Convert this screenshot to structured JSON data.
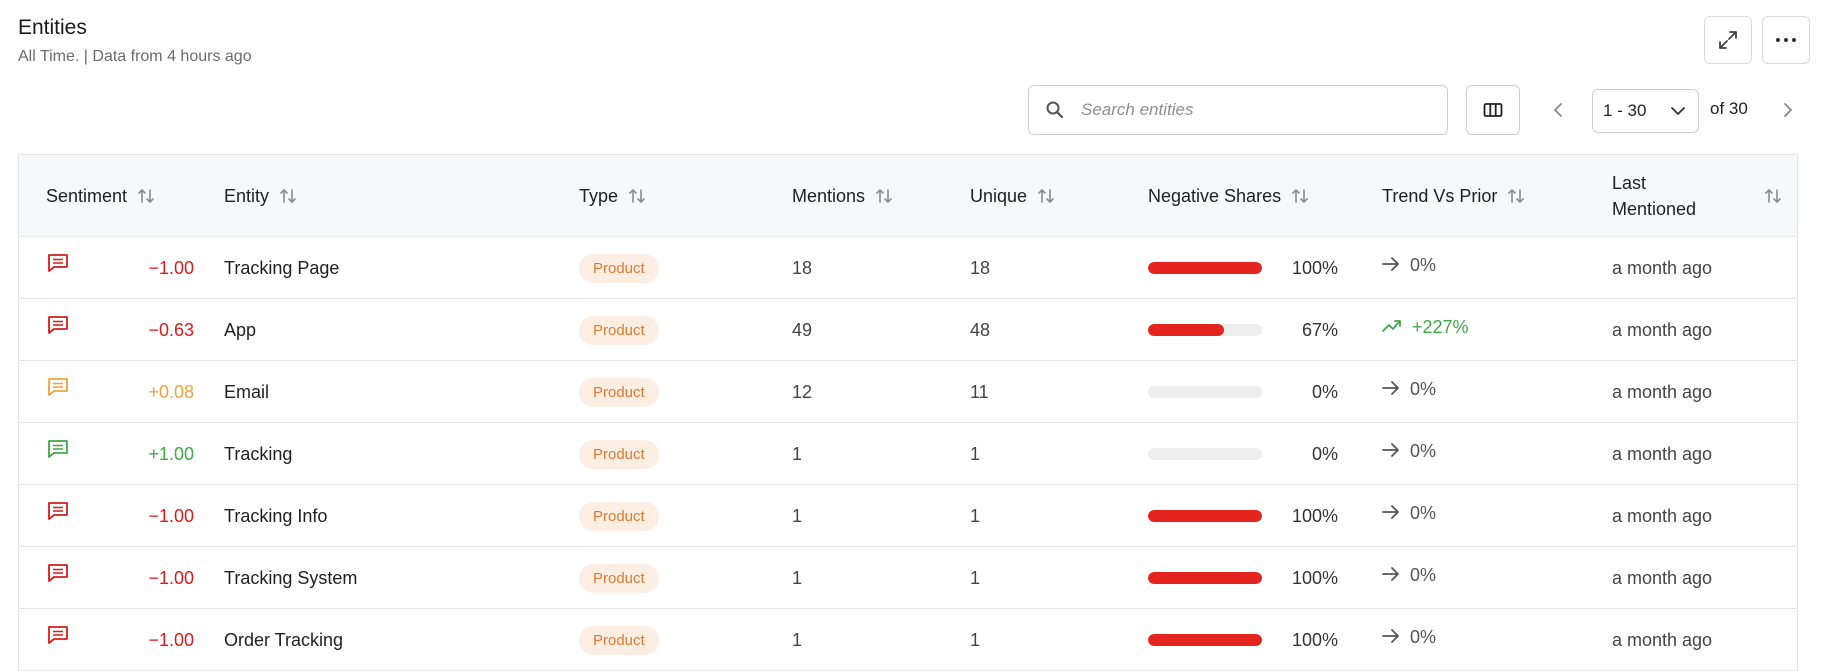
{
  "header": {
    "title": "Entities",
    "subtitle": "All Time. | Data from 4 hours ago"
  },
  "toolbar": {
    "search_placeholder": "Search entities",
    "page_range": "1 - 30",
    "page_total": "of 30"
  },
  "columns": [
    "Sentiment",
    "Entity",
    "Type",
    "Mentions",
    "Unique",
    "Negative Shares",
    "Trend Vs Prior",
    "Last",
    "Mentioned"
  ],
  "colors": {
    "negative": "#d81c1c",
    "neutral": "#f0a23a",
    "positive": "#3fa847",
    "bar": "#e52420",
    "pill_bg": "#fdeee4",
    "pill_text": "#e07a2e"
  },
  "rows": [
    {
      "score": "−1.00",
      "tone": "negative",
      "entity": "Tracking Page",
      "type": "Product",
      "mentions": "18",
      "unique": "18",
      "neg_share": 1.0,
      "neg_label": "100%",
      "trend_dir": "flat",
      "trend": "0%",
      "last": "a month ago"
    },
    {
      "score": "−0.63",
      "tone": "negative",
      "entity": "App",
      "type": "Product",
      "mentions": "49",
      "unique": "48",
      "neg_share": 0.67,
      "neg_label": "67%",
      "trend_dir": "up",
      "trend": "+227%",
      "last": "a month ago"
    },
    {
      "score": "+0.08",
      "tone": "neutral",
      "entity": "Email",
      "type": "Product",
      "mentions": "12",
      "unique": "11",
      "neg_share": 0.0,
      "neg_label": "0%",
      "trend_dir": "flat",
      "trend": "0%",
      "last": "a month ago"
    },
    {
      "score": "+1.00",
      "tone": "positive",
      "entity": "Tracking",
      "type": "Product",
      "mentions": "1",
      "unique": "1",
      "neg_share": 0.0,
      "neg_label": "0%",
      "trend_dir": "flat",
      "trend": "0%",
      "last": "a month ago"
    },
    {
      "score": "−1.00",
      "tone": "negative",
      "entity": "Tracking Info",
      "type": "Product",
      "mentions": "1",
      "unique": "1",
      "neg_share": 1.0,
      "neg_label": "100%",
      "trend_dir": "flat",
      "trend": "0%",
      "last": "a month ago"
    },
    {
      "score": "−1.00",
      "tone": "negative",
      "entity": "Tracking System",
      "type": "Product",
      "mentions": "1",
      "unique": "1",
      "neg_share": 1.0,
      "neg_label": "100%",
      "trend_dir": "flat",
      "trend": "0%",
      "last": "a month ago"
    },
    {
      "score": "−1.00",
      "tone": "negative",
      "entity": "Order Tracking",
      "type": "Product",
      "mentions": "1",
      "unique": "1",
      "neg_share": 1.0,
      "neg_label": "100%",
      "trend_dir": "flat",
      "trend": "0%",
      "last": "a month ago"
    }
  ]
}
